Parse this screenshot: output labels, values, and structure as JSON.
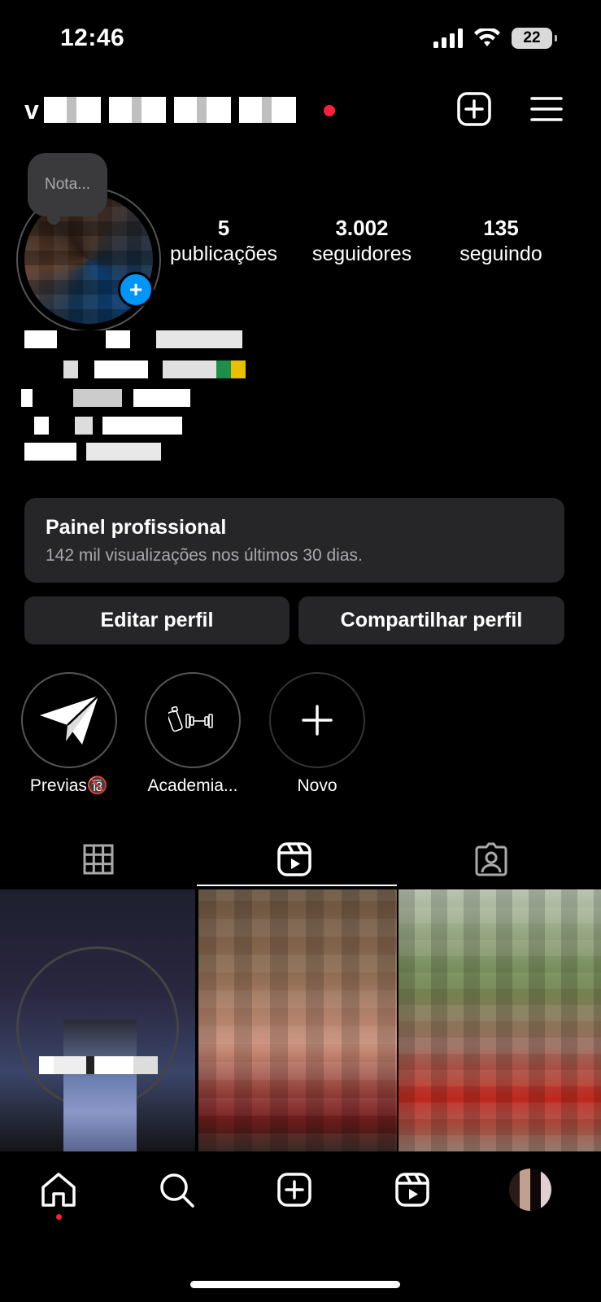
{
  "status_bar": {
    "time": "12:46",
    "battery": "22"
  },
  "header": {
    "username_initial": "v",
    "live_dot_color": "#ff1f3d",
    "icons": [
      "plus-square-icon",
      "menu-icon"
    ]
  },
  "profile": {
    "note_placeholder": "Nota...",
    "add_story_symbol": "+",
    "stats": [
      {
        "value": "5",
        "label": "publicações"
      },
      {
        "value": "3.002",
        "label": "seguidores"
      },
      {
        "value": "135",
        "label": "seguindo"
      }
    ]
  },
  "professional_panel": {
    "title": "Painel profissional",
    "subtitle": "142 mil visualizações nos últimos 30 dias."
  },
  "actions": {
    "edit_profile": "Editar perfil",
    "share_profile": "Compartilhar perfil"
  },
  "highlights": [
    {
      "label": "Previas🔞",
      "icon": "paper-plane-icon"
    },
    {
      "label": "Academia...",
      "icon": "dumbbell-bottle-icon"
    },
    {
      "label": "Novo",
      "icon": "plus-icon"
    }
  ],
  "tabs": {
    "items": [
      "grid-icon",
      "reels-icon",
      "tagged-icon"
    ],
    "active": "reels-icon"
  },
  "bottom_nav": {
    "items": [
      "home-icon",
      "search-icon",
      "create-icon",
      "reels-icon",
      "profile-avatar"
    ],
    "active": "home-icon",
    "accent": "#0095f6"
  }
}
